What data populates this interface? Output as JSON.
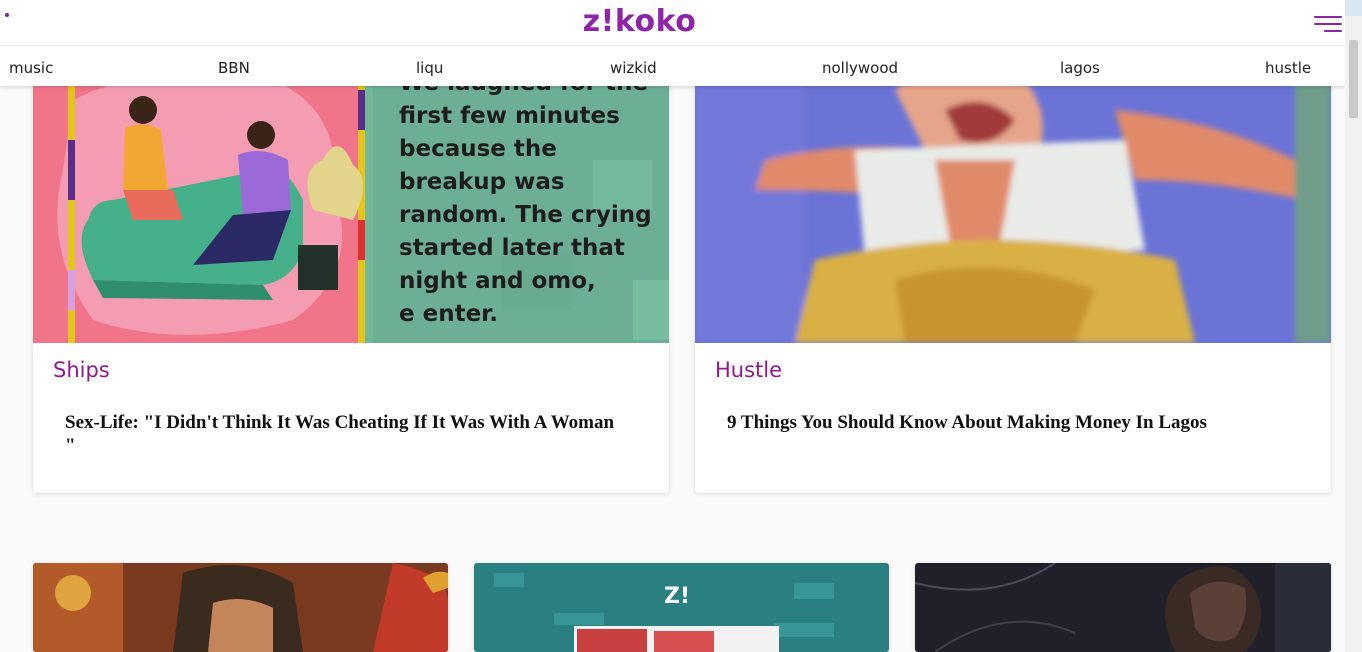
{
  "header": {
    "logo": "z!koko"
  },
  "nav": {
    "items": [
      "music",
      "BBN",
      "liqu",
      "wizkid",
      "nollywood",
      "lagos",
      "hustle"
    ]
  },
  "cards": [
    {
      "category": "Ships",
      "title": "Sex-Life: \"I Didn't Think It Was Cheating If It Was With A Woman \"",
      "image_text": [
        "We laughed for the",
        "first few minutes",
        "because the",
        "breakup was",
        "random. The crying",
        "started later that",
        "night and omo,",
        "e enter."
      ]
    },
    {
      "category": "Hustle",
      "title": "9 Things You Should Know About Making Money In Lagos"
    }
  ],
  "bottom_cards": [
    {
      "image_text": ""
    },
    {
      "image_text": "Z!"
    },
    {
      "image_text": ""
    }
  ],
  "colors": {
    "brand": "#8e24aa",
    "category": "#8e1a8e"
  }
}
